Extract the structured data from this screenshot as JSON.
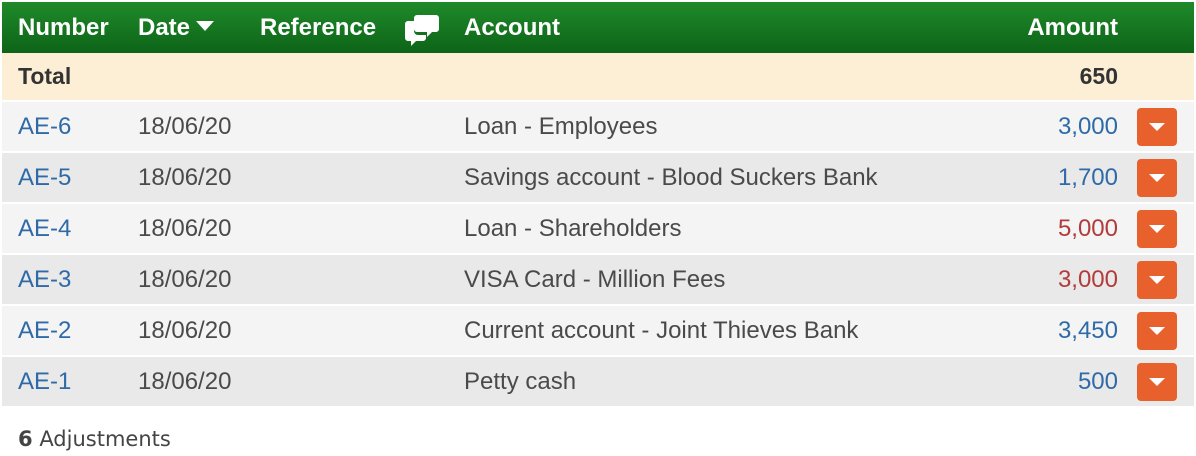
{
  "columns": {
    "number": "Number",
    "date": "Date",
    "reference": "Reference",
    "reference_icon": "comments-icon",
    "account": "Account",
    "amount": "Amount"
  },
  "total": {
    "label": "Total",
    "amount": "650"
  },
  "rows": [
    {
      "number": "AE-6",
      "date": "18/06/20",
      "account": "Loan - Employees",
      "amount": "3,000",
      "sign": "pos"
    },
    {
      "number": "AE-5",
      "date": "18/06/20",
      "account": "Savings account - Blood Suckers Bank",
      "amount": "1,700",
      "sign": "pos"
    },
    {
      "number": "AE-4",
      "date": "18/06/20",
      "account": "Loan - Shareholders",
      "amount": "5,000",
      "sign": "neg"
    },
    {
      "number": "AE-3",
      "date": "18/06/20",
      "account": "VISA Card - Million Fees",
      "amount": "3,000",
      "sign": "neg"
    },
    {
      "number": "AE-2",
      "date": "18/06/20",
      "account": "Current account - Joint Thieves Bank",
      "amount": "3,450",
      "sign": "pos"
    },
    {
      "number": "AE-1",
      "date": "18/06/20",
      "account": "Petty cash",
      "amount": "500",
      "sign": "pos"
    }
  ],
  "footer": {
    "count": "6",
    "label": "Adjustments"
  },
  "colors": {
    "header": "#157a22",
    "total_bg": "#fdefd6",
    "positive": "#2f6aa8",
    "negative": "#b23b3b",
    "action": "#e8602c"
  }
}
